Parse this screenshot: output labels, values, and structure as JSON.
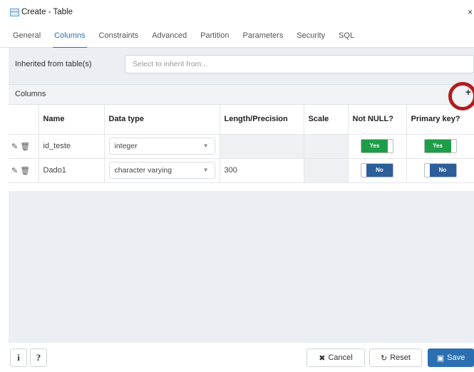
{
  "window": {
    "title": "Create - Table",
    "close_glyph": "×"
  },
  "tabs": [
    {
      "label": "General"
    },
    {
      "label": "Columns",
      "active": true
    },
    {
      "label": "Constraints"
    },
    {
      "label": "Advanced"
    },
    {
      "label": "Partition"
    },
    {
      "label": "Parameters"
    },
    {
      "label": "Security"
    },
    {
      "label": "SQL"
    }
  ],
  "inherit": {
    "label": "Inherited from table(s)",
    "placeholder": "Select to inherit from..."
  },
  "columns_panel": {
    "title": "Columns",
    "add_glyph": "+",
    "headers": [
      "Name",
      "Data type",
      "Length/Precision",
      "Scale",
      "Not NULL?",
      "Primary key?"
    ],
    "rows": [
      {
        "name": "id_teste",
        "data_type": "integer",
        "length": "",
        "scale": "",
        "not_null": "Yes",
        "primary_key": "Yes"
      },
      {
        "name": "Dado1",
        "data_type": "character varying",
        "length": "300",
        "scale": "",
        "not_null": "No",
        "primary_key": "No"
      }
    ]
  },
  "footer": {
    "info_label": "i",
    "help_label": "?",
    "cancel_label": "Cancel",
    "reset_label": "Reset",
    "save_label": "Save"
  },
  "colors": {
    "accent": "#2c6fb1",
    "yes": "#1e9d48",
    "no": "#2c5f99",
    "highlight_circle": "#b01d1d"
  }
}
